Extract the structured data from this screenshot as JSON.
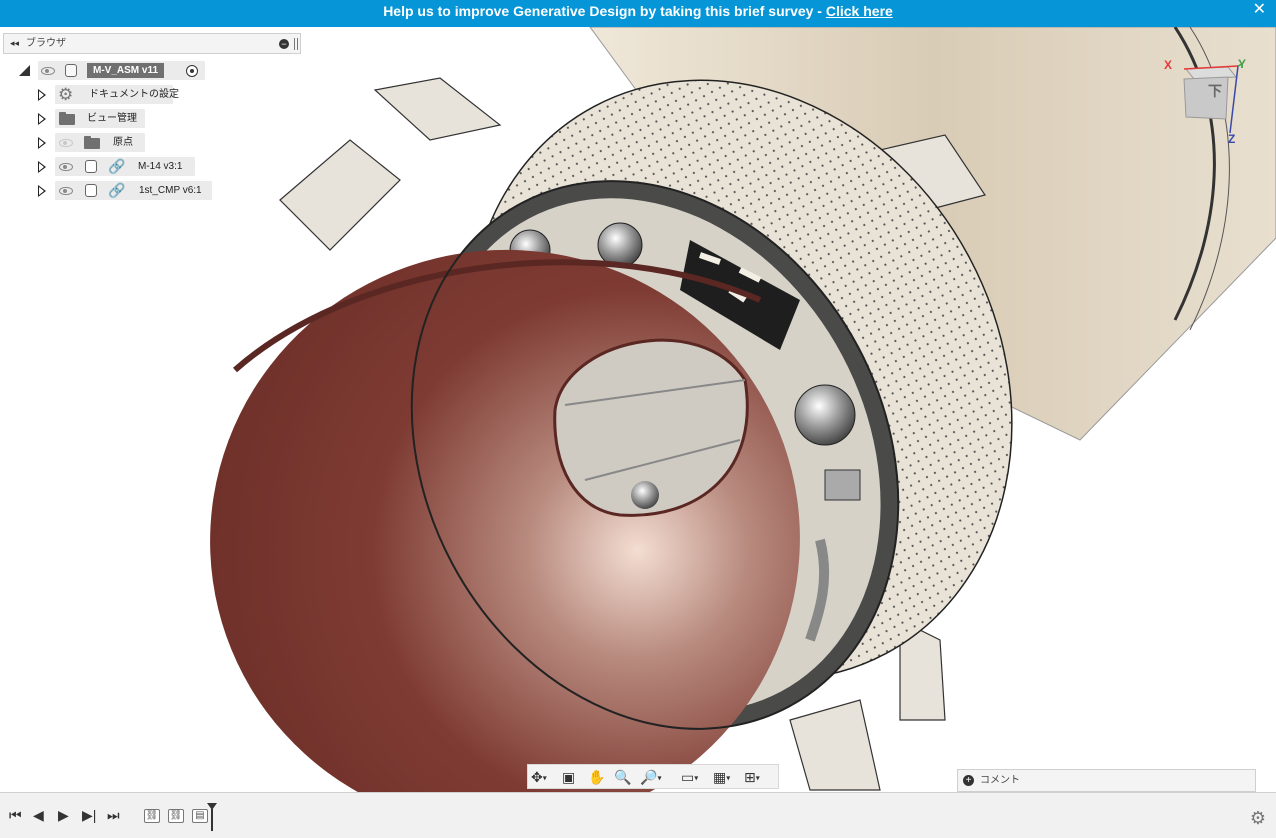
{
  "banner": {
    "message": "Help us to improve Generative Design by taking this brief survey - ",
    "link_text": "Click here",
    "close_glyph": "✕",
    "color": "#0696d7"
  },
  "browser": {
    "title": "ブラウザ",
    "collapse_glyph": "◂◂",
    "root": {
      "label": "M-V_ASM v11",
      "icons": [
        "eye-icon",
        "component-icon",
        "activate-radio-icon"
      ]
    },
    "items": [
      {
        "label": "ドキュメントの設定",
        "icon": "gear-icon"
      },
      {
        "label": "ビュー管理",
        "icon": "folder-icon"
      },
      {
        "label": "原点",
        "icon": "folder-icon",
        "visibility": "hidden"
      },
      {
        "label": "M-14 v3:1",
        "icon": "component-icon",
        "linked": true
      },
      {
        "label": "1st_CMP v6:1",
        "icon": "component-icon",
        "linked": true
      }
    ]
  },
  "viewcube": {
    "face_label": "下",
    "axes": {
      "x": "X",
      "y": "Y",
      "z": "Z"
    },
    "x_color": "#e53935",
    "y_color": "#43a047",
    "z_color": "#3949ab"
  },
  "nav_toolbar": {
    "buttons": [
      "orbit-icon",
      "look-at-icon",
      "pan-icon",
      "zoom-icon",
      "fit-icon",
      "display-settings-icon",
      "grid-settings-icon",
      "viewports-icon"
    ]
  },
  "comments": {
    "title": "コメント",
    "plus_glyph": "+"
  },
  "timeline": {
    "controls": [
      "go-to-start-icon",
      "step-back-icon",
      "play-icon",
      "step-forward-icon",
      "go-to-end-icon"
    ],
    "features": [
      "component-feature-icon",
      "component-feature-icon",
      "component-feature-icon"
    ]
  },
  "model_colors": {
    "nozzle": "#7b3a33",
    "body": "#e6dccb",
    "ring": "#4a4a48"
  }
}
